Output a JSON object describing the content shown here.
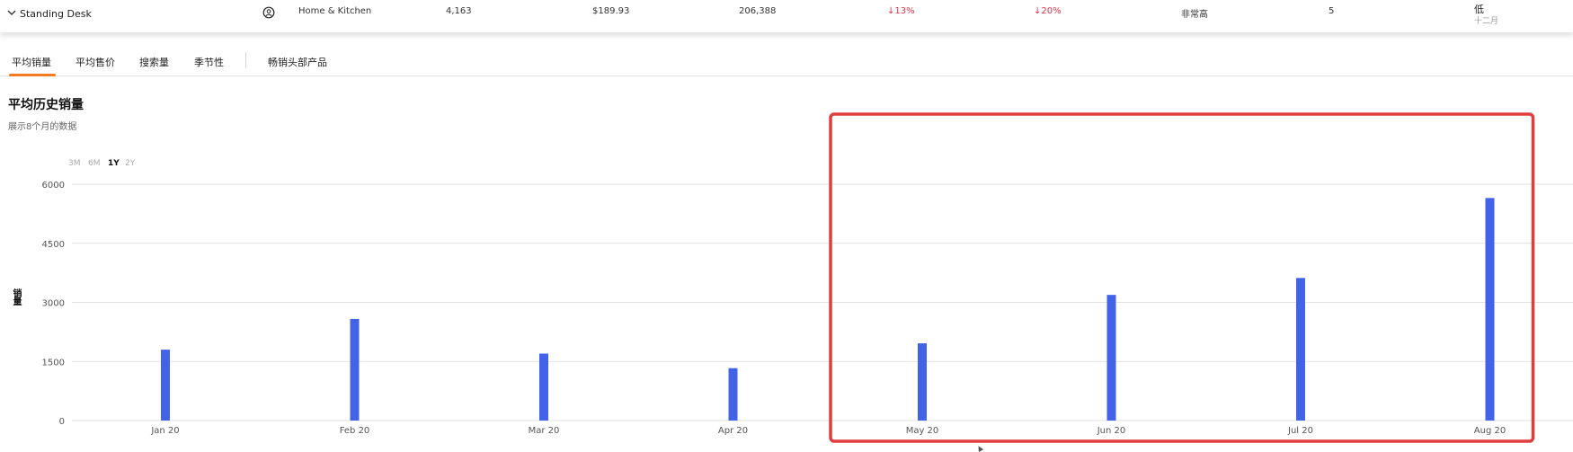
{
  "product_row": {
    "name": "Standing Desk",
    "category": "Home & Kitchen",
    "col_a": "4,163",
    "price": "$189.93",
    "col_c": "206,388",
    "change1": "↓13%",
    "change2": "↓20%",
    "level": "非常高",
    "count": "5",
    "competition": "低",
    "competition_sub": "十二月"
  },
  "tabs": [
    "平均销量",
    "平均售价",
    "搜索量",
    "季节性",
    "畅销头部产品"
  ],
  "active_tab": 0,
  "chart_header": {
    "title": "平均历史销量",
    "subtitle": "展示8个月的数据",
    "ranges": [
      "3M",
      "6M",
      "1Y",
      "2Y"
    ],
    "active_range": "1Y"
  },
  "colors": {
    "bar": "#4262e8",
    "accent_tab": "#f47b20",
    "highlight_box": "#e03d3d",
    "down": "#e0314b"
  },
  "chart_data": {
    "type": "bar",
    "title": "平均历史销量",
    "ylabel": "销量",
    "categories": [
      "Jan 20",
      "Feb 20",
      "Mar 20",
      "Apr 20",
      "May 20",
      "Jun 20",
      "Jul 20",
      "Aug 20"
    ],
    "values": [
      1800,
      2580,
      1700,
      1330,
      1960,
      3190,
      3620,
      5650
    ],
    "yticks": [
      0,
      1500,
      3000,
      4500,
      6000
    ],
    "ylim": [
      0,
      6000
    ],
    "grid": true,
    "highlight": {
      "from": "May 20",
      "to": "Aug 20"
    }
  }
}
